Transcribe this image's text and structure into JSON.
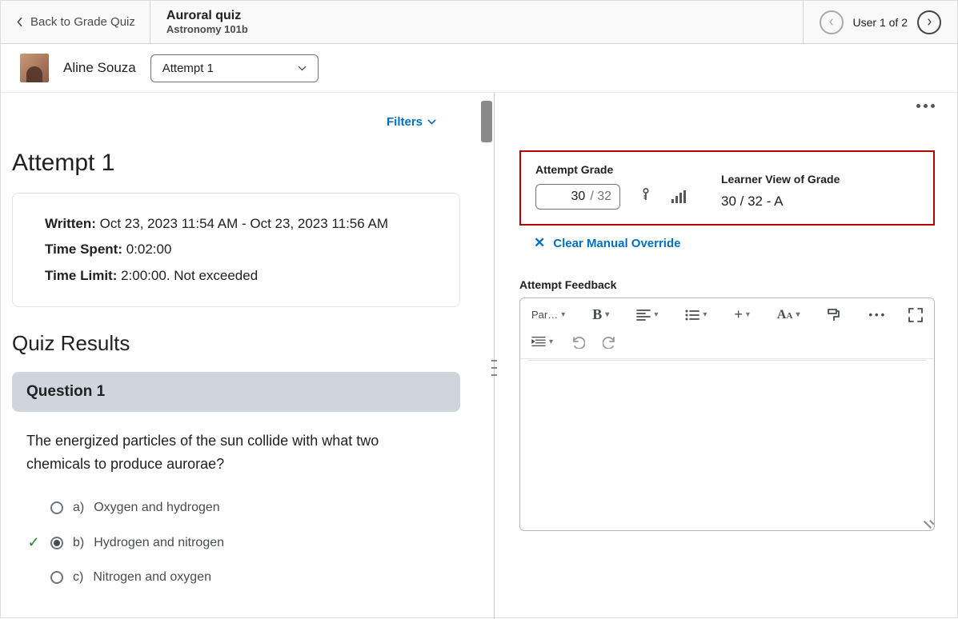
{
  "header": {
    "back_label": "Back to Grade Quiz",
    "quiz_title": "Auroral quiz",
    "course": "Astronomy 101b",
    "user_nav_label": "User 1 of 2"
  },
  "student": {
    "name": "Aline Souza",
    "attempt_selector": "Attempt 1"
  },
  "left": {
    "filters_label": "Filters",
    "attempt_heading": "Attempt 1",
    "written_label": "Written:",
    "written_value": " Oct 23, 2023 11:54 AM - Oct 23, 2023 11:56 AM",
    "timespent_label": "Time Spent:",
    "timespent_value": " 0:02:00",
    "timelimit_label": "Time Limit:",
    "timelimit_value": " 2:00:00. Not exceeded",
    "results_heading": "Quiz Results",
    "question_heading": "Question 1",
    "question_text": "The energized particles of the sun collide with what two chemicals to produce aurorae?",
    "options": [
      {
        "letter": "a)",
        "text": "Oxygen and hydrogen",
        "selected": false,
        "correct": false
      },
      {
        "letter": "b)",
        "text": "Hydrogen and nitrogen",
        "selected": true,
        "correct": true
      },
      {
        "letter": "c)",
        "text": "Nitrogen and oxygen",
        "selected": false,
        "correct": false
      }
    ]
  },
  "right": {
    "attempt_grade_label": "Attempt Grade",
    "grade_score": "30",
    "grade_max": "/ 32",
    "learner_view_label": "Learner View of Grade",
    "learner_grade": "30 / 32 - A",
    "clear_label": "Clear Manual Override",
    "feedback_label": "Attempt Feedback",
    "toolbar": {
      "paragraph": "Par…"
    }
  }
}
